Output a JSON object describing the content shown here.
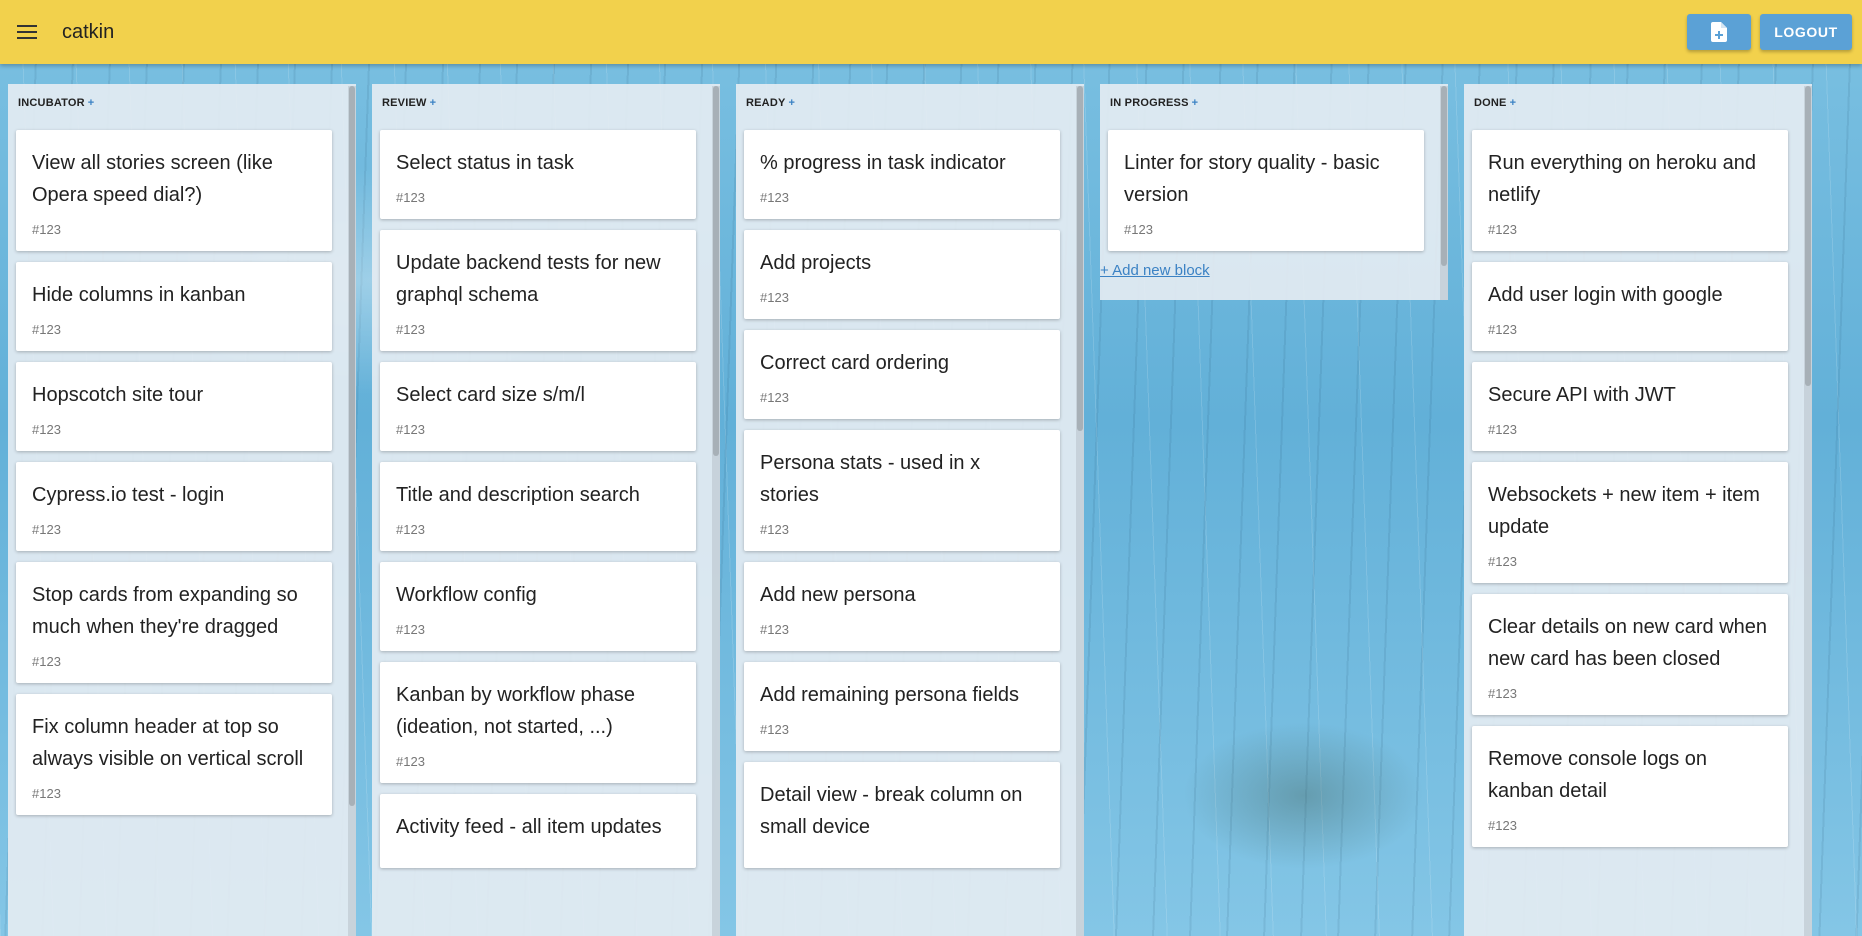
{
  "app": {
    "title": "catkin"
  },
  "toolbar": {
    "logout_label": "LOGOUT",
    "new_doc_icon": "note-add-icon"
  },
  "colors": {
    "appbar": "#f2d14c",
    "button": "#5ba1d6",
    "accent": "#3b82c4"
  },
  "columns": [
    {
      "name": "INCUBATOR",
      "add_label": "+",
      "cards": [
        {
          "title": "View all stories screen (like Opera speed dial?)",
          "id": "#123"
        },
        {
          "title": "Hide columns in kanban",
          "id": "#123"
        },
        {
          "title": "Hopscotch site tour",
          "id": "#123"
        },
        {
          "title": "Cypress.io test - login",
          "id": "#123"
        },
        {
          "title": "Stop cards from expanding so much when they're dragged",
          "id": "#123"
        },
        {
          "title": "Fix column header at top so always visible on vertical scroll",
          "id": "#123"
        }
      ]
    },
    {
      "name": "REVIEW",
      "add_label": "+",
      "cards": [
        {
          "title": "Select status in task",
          "id": "#123"
        },
        {
          "title": "Update backend tests for new graphql schema",
          "id": "#123"
        },
        {
          "title": "Select card size s/m/l",
          "id": "#123"
        },
        {
          "title": "Title and description search",
          "id": "#123"
        },
        {
          "title": "Workflow config",
          "id": "#123"
        },
        {
          "title": "Kanban by workflow phase (ideation, not started, ...)",
          "id": "#123"
        },
        {
          "title": "Activity feed - all item updates",
          "id": ""
        }
      ]
    },
    {
      "name": "READY",
      "add_label": "+",
      "cards": [
        {
          "title": "% progress in task indicator",
          "id": "#123"
        },
        {
          "title": "Add projects",
          "id": "#123"
        },
        {
          "title": "Correct card ordering",
          "id": "#123"
        },
        {
          "title": "Persona stats - used in x stories",
          "id": "#123"
        },
        {
          "title": "Add new persona",
          "id": "#123"
        },
        {
          "title": "Add remaining persona fields",
          "id": "#123"
        },
        {
          "title": "Detail view - break column on small device",
          "id": ""
        }
      ]
    },
    {
      "name": "IN PROGRESS",
      "add_label": "+",
      "cards": [
        {
          "title": "Linter for story quality - basic version",
          "id": "#123"
        }
      ],
      "add_block_label": "+ Add new block"
    },
    {
      "name": "DONE",
      "add_label": "+",
      "cards": [
        {
          "title": "Run everything on heroku and netlify",
          "id": "#123"
        },
        {
          "title": "Add user login with google",
          "id": "#123"
        },
        {
          "title": "Secure API with JWT",
          "id": "#123"
        },
        {
          "title": "Websockets + new item + item update",
          "id": "#123"
        },
        {
          "title": "Clear details on new card when new card has been closed",
          "id": "#123"
        },
        {
          "title": "Remove console logs on kanban detail",
          "id": "#123"
        }
      ]
    }
  ]
}
